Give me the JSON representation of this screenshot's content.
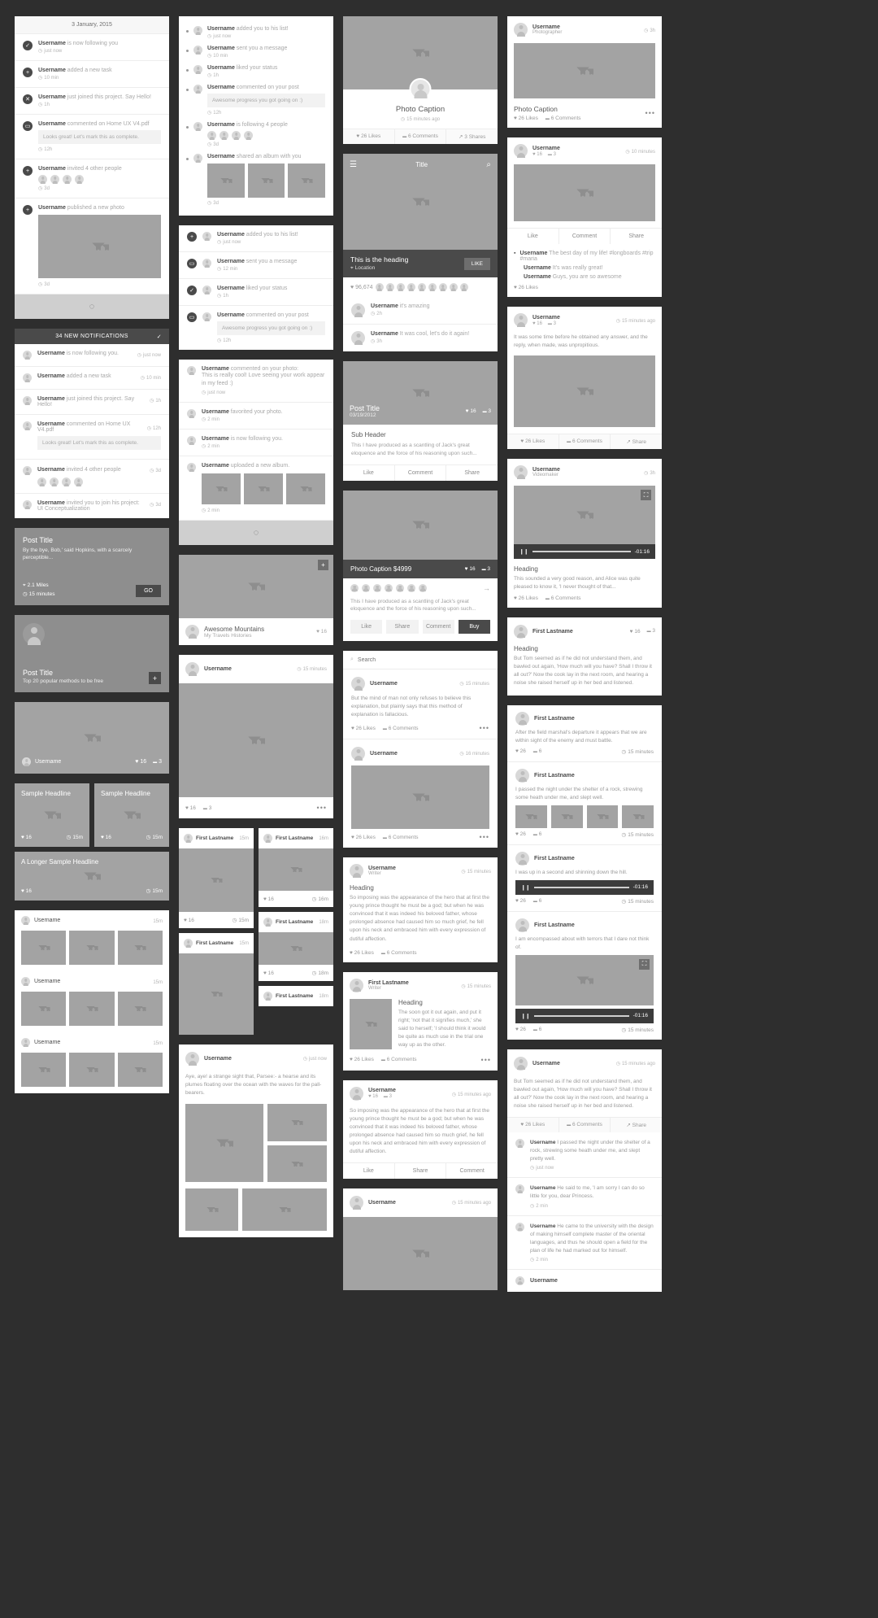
{
  "meta": {
    "bg": "#2e2e2e",
    "accent": "#4a4a4a",
    "placeholder": "#a3a3a3"
  },
  "labels": {
    "username": "Username",
    "first_lastname": "First Lastname",
    "like": "Like",
    "like_caps": "LIKE",
    "comment": "Comment",
    "share": "Share",
    "buy": "Buy",
    "go": "GO",
    "search": "Search",
    "dots": "•••"
  },
  "col1": {
    "activity_card": {
      "date": "3 January, 2015",
      "items": [
        {
          "icon": "✓",
          "user": "Username",
          "text": " is now following you",
          "time": "just now"
        },
        {
          "icon": "+",
          "user": "Username",
          "text": " added a new task",
          "time": "10 min"
        },
        {
          "icon": "✕",
          "user": "Username",
          "text": " just joined this project. Say Hello!",
          "time": "1h"
        },
        {
          "icon": "▭",
          "user": "Username",
          "text": " commented on Home UX V4.pdf",
          "quote": "Looks great! Let's mark this as complete.",
          "time": "12h"
        },
        {
          "icon": "+",
          "user": "Username",
          "text": " invited 4 other people",
          "avatars": 4,
          "time": "3d"
        },
        {
          "icon": "+",
          "user": "Username",
          "text": " published a new photo",
          "photo": true,
          "time": "3d"
        }
      ],
      "loading": "◌"
    },
    "notifications_card": {
      "header": "34 NEW NOTIFICATIONS",
      "header_icon": "✓",
      "items": [
        {
          "user": "Username",
          "text": " is now following you.",
          "time": "just now"
        },
        {
          "user": "Username",
          "text": " added a new task",
          "time": "10 min"
        },
        {
          "user": "Username",
          "text": " just joined this project. Say Hello!",
          "time": "1h"
        },
        {
          "user": "Username",
          "text": " commented on Home UX V4.pdf",
          "time": "12h",
          "quote": "Looks great! Let's mark this as complete."
        },
        {
          "user": "Username",
          "text": " invited 4 other people",
          "time": "3d",
          "avatars": 4
        },
        {
          "user": "Username",
          "text": " invited you to join his project:",
          "text2": "UI Conceptualization",
          "time": "3d"
        }
      ]
    },
    "post_card_a": {
      "title": "Post Title",
      "excerpt": "By the bye, Bob,' said Hopkins, with a scarcely perceptible...",
      "distance": "2.1 Miles",
      "duration": "15 minutes",
      "action": "GO"
    },
    "post_card_b": {
      "title": "Post Title",
      "subtitle": "Top 20 popular methods to be free",
      "action": "+"
    },
    "photo_card": {
      "user": "Username",
      "likes": "16",
      "comments": "3"
    },
    "headlines": [
      {
        "title": "Sample Headline",
        "likes": "16",
        "time": "15m"
      },
      {
        "title": "Sample Headline",
        "likes": "16",
        "time": "15m"
      },
      {
        "title": "A Longer Sample Headline",
        "likes": "16",
        "time": "15m"
      }
    ],
    "gallery": [
      {
        "user": "Username",
        "time": "15m",
        "cells": 3
      },
      {
        "user": "Username",
        "time": "15m",
        "cells": 3
      },
      {
        "user": "Username",
        "time": "15m",
        "cells": 3
      }
    ]
  },
  "col2": {
    "timeline_card": {
      "items": [
        {
          "user": "Username",
          "text": " added you to his list!",
          "time": "just now"
        },
        {
          "user": "Username",
          "text": " sent you a message",
          "time": "10 min"
        },
        {
          "user": "Username",
          "text": " liked your status",
          "time": "1h"
        },
        {
          "user": "Username",
          "text": " commented on your post",
          "quote": "Awesome progress you got going on :)",
          "time": "12h"
        },
        {
          "user": "Username",
          "text": " is following 4 people",
          "avatars": 4,
          "time": "3d"
        },
        {
          "user": "Username",
          "text": " shared an album with you",
          "photos": 3,
          "time": "3d"
        }
      ]
    },
    "badge_card": {
      "items": [
        {
          "icon": "+",
          "user": "Username",
          "text": " added you to his list!",
          "time": "just now"
        },
        {
          "icon": "▭",
          "user": "Username",
          "text": " sent you a message",
          "time": "12 min"
        },
        {
          "icon": "✓",
          "user": "Username",
          "text": " liked your status",
          "time": "1h"
        },
        {
          "icon": "▭",
          "user": "Username",
          "text": " commented on your post",
          "quote": "Awesome progress you got going on :)",
          "time": "12h"
        }
      ]
    },
    "simple_card": {
      "items": [
        {
          "user": "Username",
          "text": " commented on your photo:",
          "text2": "This is really cool! Love seeing your work appear in my feed :)",
          "time": "just now"
        },
        {
          "user": "Username",
          "text": " favorited your photo.",
          "time": "2 min"
        },
        {
          "user": "Username",
          "text": " is now following you.",
          "time": "2 min"
        },
        {
          "user": "Username",
          "text": " uploaded a new album.",
          "photos": 3,
          "time": "2 min"
        }
      ],
      "loading": "◌"
    },
    "mountains_card": {
      "title": "Awesome Mountains",
      "subtitle": "My Travels Histories",
      "likes": "16",
      "action": "+"
    },
    "user_photo_card": {
      "user": "Username",
      "time": "15 minutes",
      "likes": "16",
      "comments": "3",
      "dots": "•••"
    },
    "masonry": [
      {
        "user": "First Lastname",
        "time": "15m",
        "likes": "16"
      },
      {
        "user": "First Lastname",
        "time": "16m",
        "likes": "16"
      },
      {
        "user": "First Lastname",
        "time": "15m",
        "likes": "16"
      },
      {
        "user": "First Lastname",
        "time": "18m",
        "likes": "16"
      },
      {
        "user": "First Lastname",
        "time": "15m",
        "likes": "16"
      },
      {
        "user": "First Lastname",
        "time": "18m",
        "likes": "16"
      }
    ],
    "quote_card": {
      "user": "Username",
      "time": "just now",
      "text": "Aye, aye! a strange sight that, Parsee:- a hearse and its plumes floating over the ocean with the waves for the pall-bearers."
    }
  },
  "col3": {
    "photo_caption_card": {
      "caption": "Photo Caption",
      "time": "15 minutes ago",
      "likes": "26 Likes",
      "comments": "6 Comments",
      "shares": "3 Shares"
    },
    "heading_card": {
      "nav_title": "Title",
      "menu_icon": "☰",
      "search_icon": "⌕",
      "heading": "This is the heading",
      "location": "Location",
      "like": "LIKE",
      "like_count": "96,674",
      "comments": [
        {
          "user": "Username",
          "text": " it's amazing",
          "time": "2h"
        },
        {
          "user": "Username",
          "text": " It was cool, let's do it again!",
          "time": "3h"
        }
      ]
    },
    "post_title_card": {
      "title": "Post Title",
      "date": "03/19/2012",
      "likes": "16",
      "comments": "3",
      "subheader": "Sub Header",
      "body": "This I have produced as a scantling of Jack's great eloquence and the force of his reasoning upon such...",
      "actions": [
        "Like",
        "Comment",
        "Share"
      ]
    },
    "product_card": {
      "caption": "Photo Caption $4999",
      "likes": "16",
      "comments": "3",
      "body": "This I have produced as a scantling of Jack's great eloquence and the force of his reasoning upon such...",
      "actions": [
        "Like",
        "Share",
        "Comment"
      ],
      "buy": "Buy",
      "arrow": "→"
    },
    "search_feed": {
      "search_placeholder": "Search",
      "items": [
        {
          "user": "Username",
          "time": "15 minutes",
          "text": "But the mind of man not only refuses to believe this explanation, but plainly says that this method of explanation is fallacious.",
          "likes": "26 Likes",
          "comments": "6 Comments",
          "dots": "•••"
        },
        {
          "user": "Username",
          "time": "16 minutes",
          "photo": true,
          "likes": "26 Likes",
          "comments": "6 Comments",
          "dots": "•••"
        }
      ]
    },
    "article_card": {
      "user": "Username",
      "role": "Writer",
      "time": "15 minutes",
      "heading": "Heading",
      "body": "So imposing was the appearance of the hero that at first the young prince thought he must be a god; but when he was convinced that it was indeed his beloved father, whose prolonged absence had caused him so much grief, he fell upon his neck and embraced him with every expression of dutiful affection.",
      "likes": "26 Likes",
      "comments": "6 Comments"
    },
    "quote_card": {
      "user": "First Lastname",
      "role": "Writer",
      "time": "15 minutes",
      "heading": "Heading",
      "body": "The soon got it out again, and put it right; 'not that it signifies much,' she said to herself; 'I should think it would be quite as much use in the trial one way up as the other.",
      "likes": "26 Likes",
      "comments": "6 Comments",
      "dots": "•••"
    },
    "engage_card": {
      "user": "Username",
      "likes": "16",
      "comments": "3",
      "time": "15 minutes ago",
      "body": "So imposing was the appearance of the hero that at first the young prince thought he must be a god; but when he was convinced that it was indeed his beloved father, whose prolonged absence had caused him so much grief, he fell upon his neck and embraced him with every expression of dutiful affection.",
      "actions": [
        "Like",
        "Share",
        "Comment"
      ]
    },
    "last_card": {
      "user": "Username",
      "time": "15 minutes ago"
    }
  },
  "col4": {
    "photographer_card": {
      "user": "Username",
      "role": "Photographer",
      "time": "3h",
      "caption": "Photo Caption",
      "likes": "26 Likes",
      "comments": "6 Comments",
      "dots": "•••"
    },
    "tagged_card": {
      "user": "Username",
      "time": "10 minutes",
      "likes": "16",
      "comments": "3",
      "actions": [
        "Like",
        "Comment",
        "Share"
      ],
      "comments_list": [
        {
          "user": "Username",
          "text": " The best day of my life! #longboards #trip #maria"
        },
        {
          "user": "Username",
          "text": " It's was really great!"
        },
        {
          "user": "Username",
          "text": " Guys, you are so awesome"
        }
      ],
      "likes_footer": "26 Likes"
    },
    "text_photo_card": {
      "user": "Username",
      "likes": "16",
      "comments": "3",
      "time": "15 minutes ago",
      "text": "It was some time before he obtained any answer, and the reply, when made, was unpropitious.",
      "likes_footer": "26 Likes",
      "comments_footer": "6 Comments",
      "share_footer": "Share"
    },
    "video_card": {
      "user": "Username",
      "role": "Videomaker",
      "time": "3h",
      "time_remaining": "-01:16",
      "heading": "Heading",
      "body": "This sounded a very good reason, and Alice was quite pleased to know it, 'I never thought of that...",
      "likes": "26 Likes",
      "comments": "6 Comments",
      "expand_icon": "⛶",
      "pause_icon": "❙❙"
    },
    "story_card": {
      "user": "First Lastname",
      "likes": "16",
      "comments": "3",
      "heading": "Heading",
      "body": "But Tom seemed as if he did not understand them, and bawled out again, 'How much will you have? Shall I throw it all out?' Now the cook lay in the next room, and hearing a noise she raised herself up in her bed and listened."
    },
    "thread_card": {
      "items": [
        {
          "user": "First Lastname",
          "text": "After the field marshal's departure it appears that we are within sight of the enemy and must battle.",
          "likes": "26",
          "comments": "6",
          "time": "15 minutes"
        },
        {
          "user": "First Lastname",
          "text": "I passed the night under the shelter of a rock, strewing some heath under me, and slept well.",
          "photos": 4,
          "likes": "26",
          "comments": "6",
          "time": "15 minutes"
        },
        {
          "user": "First Lastname",
          "text": "I was up in a second and shinning down the hill.",
          "audio": "-01:16",
          "likes": "26",
          "comments": "6",
          "time": "15 minutes"
        },
        {
          "user": "First Lastname",
          "text": "I am encompassed about with terrors that I dare not think of.",
          "video": true,
          "audio": "-01:16",
          "likes": "26",
          "comments": "6",
          "time": "15 minutes"
        }
      ]
    },
    "comments_card": {
      "user": "Username",
      "time": "15 minutes ago",
      "body": "But Tom seemed as if he did not understand them, and bawled out again, 'How much will you have? Shall I throw it all out?' Now the cook lay in the next room, and hearing a noise she raised herself up in her bed and listened.",
      "stats": [
        "26 Likes",
        "6 Comments",
        "Share"
      ],
      "comments": [
        {
          "user": "Username",
          "text": " I passed the night under the shelter of a rock, strewing some heath under me, and slept pretty well.",
          "time": "just now"
        },
        {
          "user": "Username",
          "text": " He said to me, 'I am sorry I can do so little for you, dear Princess.",
          "time": "2 min"
        },
        {
          "user": "Username",
          "text": " He came to the university with the design of making himself complete master of the oriental languages, and thus he should open a field for the plan of life he had marked out for himself.",
          "time": "2 min"
        }
      ],
      "footer_user": "Username"
    }
  }
}
